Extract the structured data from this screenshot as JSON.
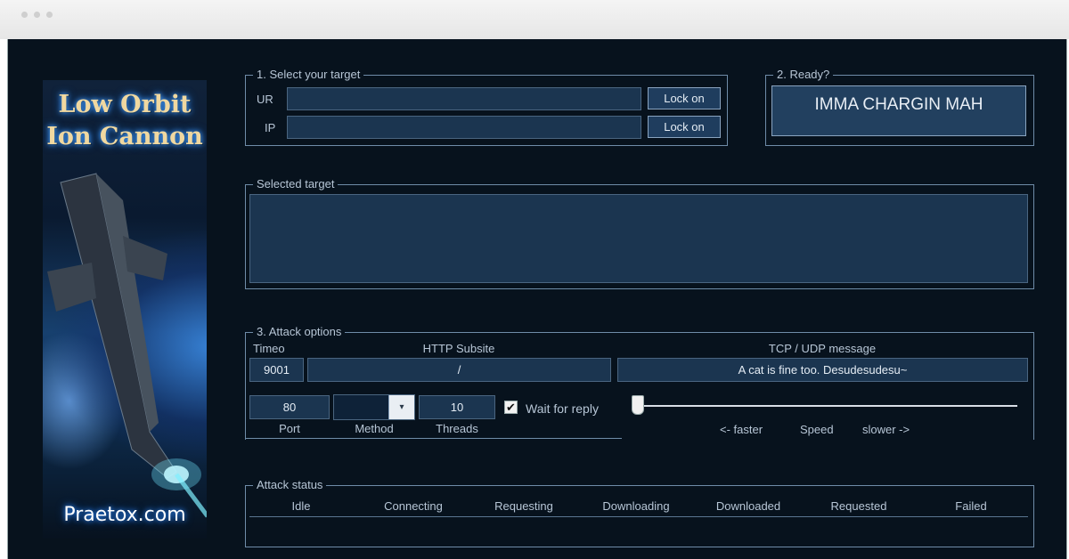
{
  "banner": {
    "title_line1": "Low Orbit",
    "title_line2": "Ion Cannon",
    "site": "Praetox.com"
  },
  "target": {
    "legend": "1. Select your target",
    "url_label": "UR",
    "url_value": "",
    "url_button": "Lock on",
    "ip_label": "IP",
    "ip_value": "",
    "ip_button": "Lock on"
  },
  "ready": {
    "legend": "2. Ready?",
    "fire_button": "IMMA CHARGIN MAH"
  },
  "selected": {
    "legend": "Selected target",
    "value": ""
  },
  "options": {
    "legend": "3. Attack options",
    "timeout_label": "Timeo",
    "timeout_value": "9001",
    "subsite_label": "HTTP Subsite",
    "subsite_value": "/",
    "message_label": "TCP / UDP message",
    "message_value": "A cat is fine too. Desudesudesu~",
    "port_value": "80",
    "port_label": "Port",
    "method_value": "",
    "method_label": "Method",
    "threads_value": "10",
    "threads_label": "Threads",
    "wait_label": "Wait for reply",
    "wait_checked": true,
    "speed_faster": "<- faster",
    "speed_label": "Speed",
    "speed_slower": "slower ->",
    "speed_level": 0.0
  },
  "status": {
    "legend": "Attack status",
    "columns": [
      "Idle",
      "Connecting",
      "Requesting",
      "Downloading",
      "Downloaded",
      "Requested",
      "Failed"
    ]
  }
}
